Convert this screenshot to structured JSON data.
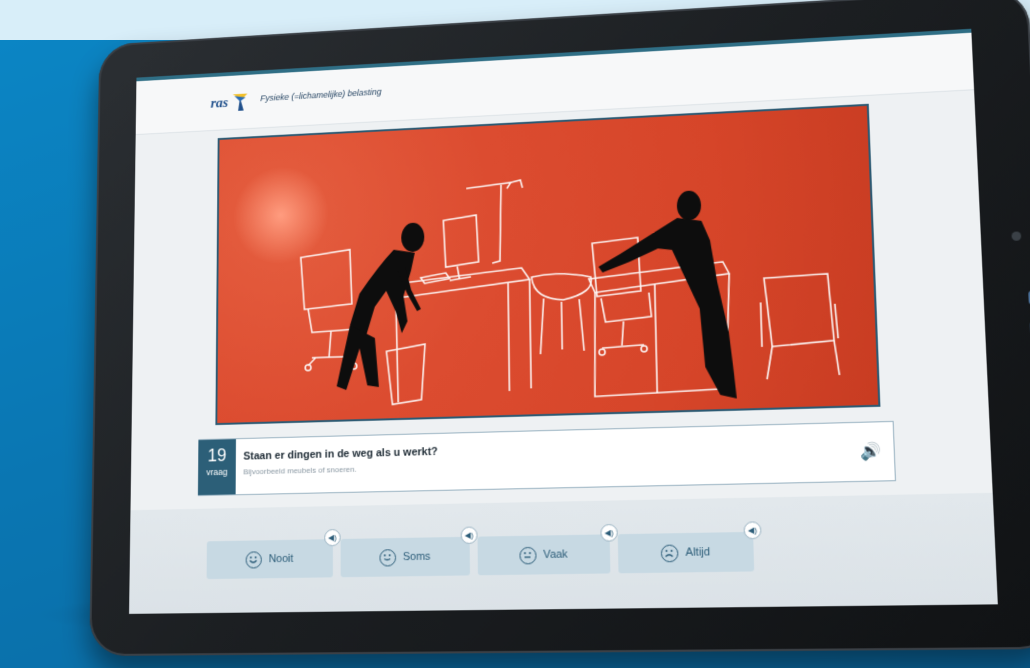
{
  "header": {
    "logo": "ras",
    "title": "Fysieke (=lichamelijke) belasting"
  },
  "question": {
    "number": "19",
    "label": "vraag",
    "text": "Staan er dingen in de weg als u werkt?",
    "hint": "Bijvoorbeeld meubels of snoeren."
  },
  "answers": [
    {
      "label": "Nooit",
      "icon": "smile-icon"
    },
    {
      "label": "Soms",
      "icon": "slight-smile-icon"
    },
    {
      "label": "Vaak",
      "icon": "neutral-face-icon"
    },
    {
      "label": "Altijd",
      "icon": "sad-face-icon"
    }
  ],
  "colors": {
    "scene_background": "#dc4c30",
    "accent": "#2c5f78",
    "answer_button": "#c7d9e3"
  }
}
